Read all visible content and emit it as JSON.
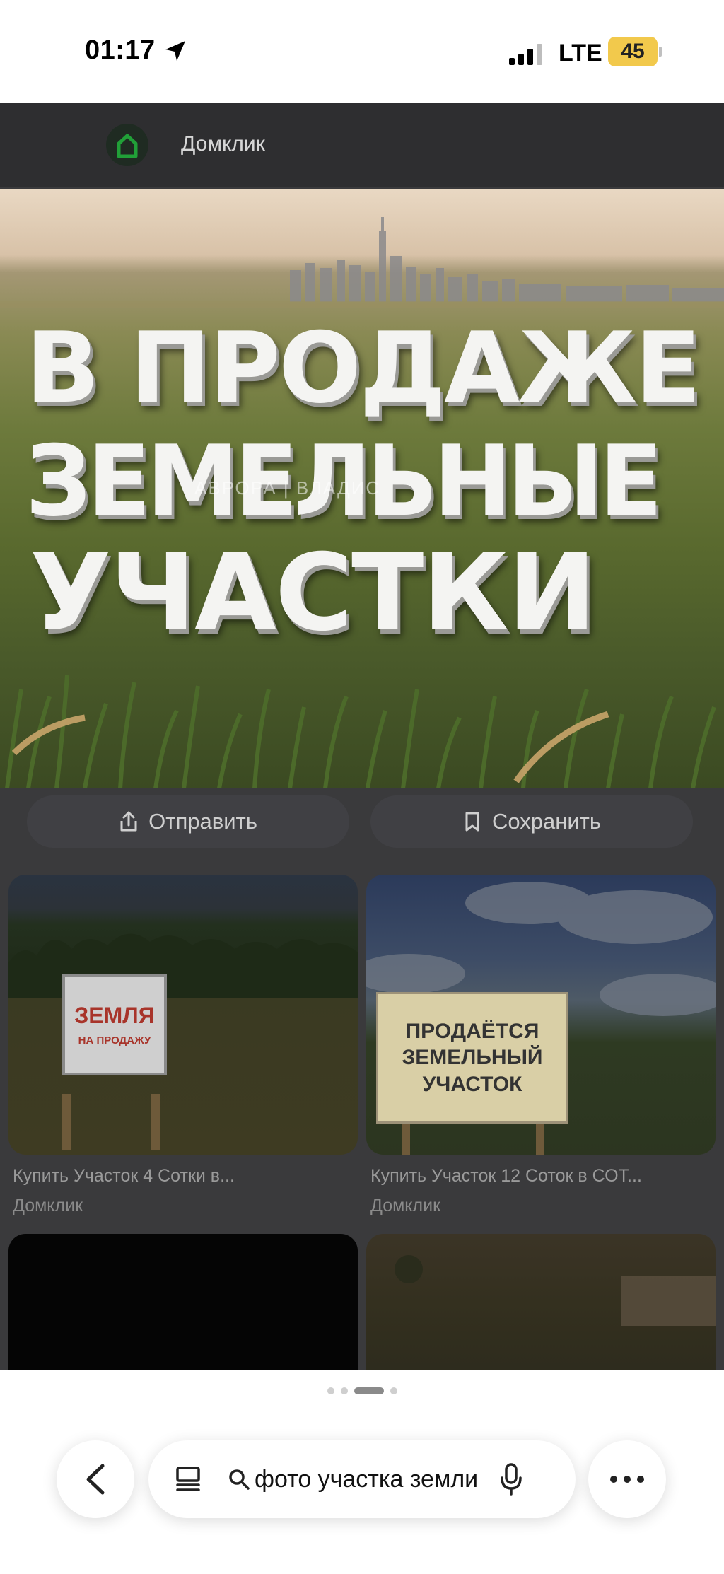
{
  "status_bar": {
    "time": "01:17",
    "network": "LTE",
    "battery": "45",
    "battery_color": "#f2c94c"
  },
  "viewer": {
    "source": {
      "name": "Домклик",
      "icon": "home-icon"
    },
    "hero": {
      "lines": [
        "В ПРОДАЖЕ",
        "ЗЕМЕЛЬНЫЕ",
        "УЧАСТКИ"
      ],
      "watermark": "АВРОРА | ВЛАДИС"
    },
    "actions": {
      "share_label": "Отправить",
      "share_icon": "share-icon",
      "save_label": "Сохранить",
      "save_icon": "bookmark-icon"
    },
    "results": [
      {
        "title": "Купить Участок 4 Сотки в...",
        "source": "Домклик",
        "sign_line1": "ЗЕМЛЯ",
        "sign_line2": "НА ПРОДАЖУ"
      },
      {
        "title": "Купить Участок 12 Соток в СОТ...",
        "source": "Домклик",
        "sign_lines": [
          "ПРОДАЁТСЯ",
          "ЗЕМЕЛЬНЫЙ",
          "УЧАСТОК"
        ]
      },
      {
        "title": "",
        "source": ""
      },
      {
        "title": "",
        "source": ""
      }
    ]
  },
  "pagination": {
    "total": 4,
    "active": 3
  },
  "bottom_bar": {
    "query": "фото участка земли",
    "back_icon": "chevron-left-icon",
    "tabs_icon": "tabs-icon",
    "search_icon": "search-icon",
    "mic_icon": "microphone-icon",
    "more_icon": "more-icon"
  }
}
